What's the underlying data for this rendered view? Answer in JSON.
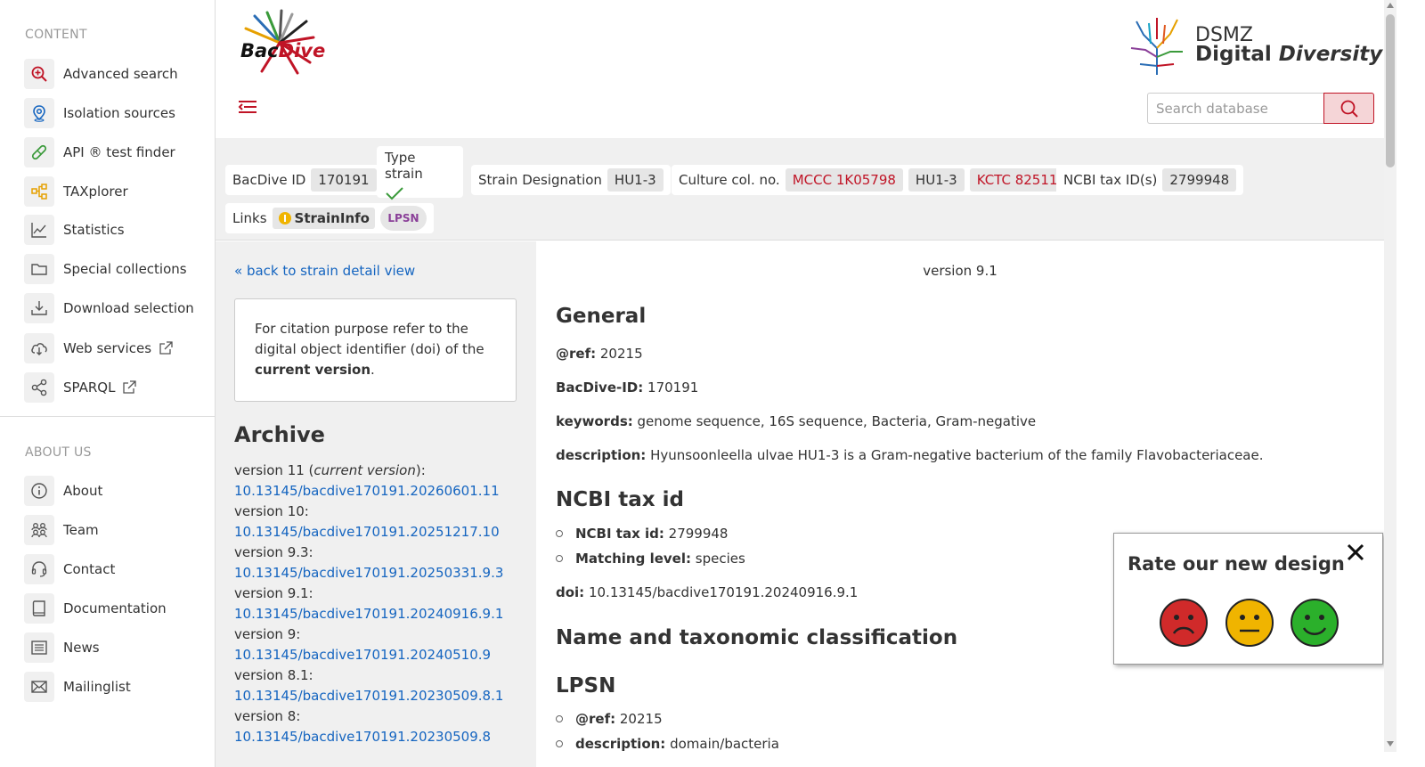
{
  "sidebar": {
    "content_heading": "CONTENT",
    "content_items": [
      {
        "label": "Advanced search",
        "icon": "search-plus-icon"
      },
      {
        "label": "Isolation sources",
        "icon": "map-pin-icon"
      },
      {
        "label": "API ® test finder",
        "icon": "test-strip-icon"
      },
      {
        "label": "TAXplorer",
        "icon": "tree-icon"
      },
      {
        "label": "Statistics",
        "icon": "chart-line-icon"
      },
      {
        "label": "Special collections",
        "icon": "folder-icon"
      },
      {
        "label": "Download selection",
        "icon": "download-icon"
      },
      {
        "label": "Web services",
        "icon": "cloud-download-icon"
      },
      {
        "label": "SPARQL",
        "icon": "share-nodes-icon"
      }
    ],
    "about_heading": "ABOUT US",
    "about_items": [
      {
        "label": "About",
        "icon": "info-icon"
      },
      {
        "label": "Team",
        "icon": "team-icon"
      },
      {
        "label": "Contact",
        "icon": "headset-icon"
      },
      {
        "label": "Documentation",
        "icon": "book-icon"
      },
      {
        "label": "News",
        "icon": "newspaper-icon"
      },
      {
        "label": "Mailinglist",
        "icon": "mail-icon"
      }
    ]
  },
  "header": {
    "logo_text_a": "Bac",
    "logo_text_b": "Dive",
    "dsmz_line1": "DSMZ",
    "dsmz_line2a": "Digital ",
    "dsmz_line2b": "Diversity",
    "search_placeholder": "Search database"
  },
  "strain": {
    "bacdive_id_label": "BacDive ID",
    "bacdive_id": "170191",
    "type_strain_label": "Type strain",
    "designation_label": "Strain Designation",
    "designation": "HU1-3",
    "culture_label": "Culture col. no.",
    "culture_1": "MCCC 1K05798",
    "culture_2": "HU1-3",
    "culture_3": "KCTC 82511",
    "ncbi_label": "NCBI tax ID(s)",
    "ncbi_id": "2799948",
    "links_label": "Links",
    "straininfo_label": "StrainInfo",
    "lpsn_label": "LPSN"
  },
  "left": {
    "back_link": "« back to strain detail view",
    "cite_text_1": "For citation purpose refer to the digital object identifier (doi) of the ",
    "cite_text_bold": "current version",
    "cite_text_2": ".",
    "archive_title": "Archive",
    "archive": [
      {
        "label": "version 11 (",
        "label_it": "current version",
        "label_end": "):",
        "doi": "10.13145/bacdive170191.20260601.11"
      },
      {
        "label": "version 10:",
        "doi": "10.13145/bacdive170191.20251217.10"
      },
      {
        "label": "version 9.3:",
        "doi": "10.13145/bacdive170191.20250331.9.3"
      },
      {
        "label": "version 9.1:",
        "doi": "10.13145/bacdive170191.20240916.9.1"
      },
      {
        "label": "version 9:",
        "doi": "10.13145/bacdive170191.20240510.9"
      },
      {
        "label": "version 8.1:",
        "doi": "10.13145/bacdive170191.20230509.8.1"
      },
      {
        "label": "version 8:",
        "doi": "10.13145/bacdive170191.20230509.8"
      }
    ]
  },
  "main": {
    "version": "version 9.1",
    "general_title": "General",
    "ref_label": "@ref:",
    "ref_value": "20215",
    "bacdive_label": "BacDive-ID:",
    "bacdive_value": "170191",
    "keywords_label": "keywords:",
    "keywords_value": "genome sequence, 16S sequence, Bacteria, Gram-negative",
    "description_label": "description:",
    "description_value": "Hyunsoonleella ulvae HU1-3 is a Gram-negative bacterium of the family Flavobacteriaceae.",
    "ncbi_title": "NCBI tax id",
    "ncbi_tax_label": "NCBI tax id:",
    "ncbi_tax_value": "2799948",
    "matching_label": "Matching level:",
    "matching_value": "species",
    "doi_label": "doi:",
    "doi_value": "10.13145/bacdive170191.20240916.9.1",
    "name_title": "Name and taxonomic classification",
    "lpsn_title": "LPSN",
    "lpsn_ref_label": "@ref:",
    "lpsn_ref_value": "20215",
    "lpsn_desc_label": "description:",
    "lpsn_desc_value": "domain/bacteria"
  },
  "rating": {
    "title": "Rate our new design"
  },
  "colors": {
    "accent": "#c01426",
    "link": "#1565c0"
  }
}
